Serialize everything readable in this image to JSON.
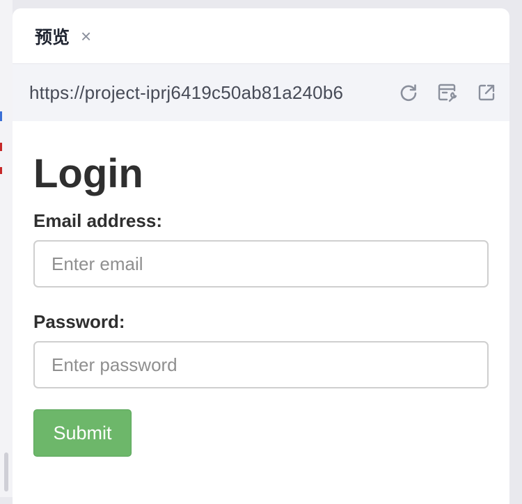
{
  "tab": {
    "title": "预览",
    "close_symbol": "×"
  },
  "urlbar": {
    "url": "https://project-iprj6419c50ab81a240b6",
    "icons": [
      "refresh-icon",
      "devtools-icon",
      "open-external-icon"
    ]
  },
  "form": {
    "title": "Login",
    "email_label": "Email address:",
    "email_placeholder": "Enter email",
    "email_value": "",
    "password_label": "Password:",
    "password_placeholder": "Enter password",
    "password_value": "",
    "submit_label": "Submit"
  },
  "colors": {
    "submit_background": "#6db76a",
    "urlbar_background": "#f3f4f8",
    "icon_color": "#8a8f9c"
  }
}
